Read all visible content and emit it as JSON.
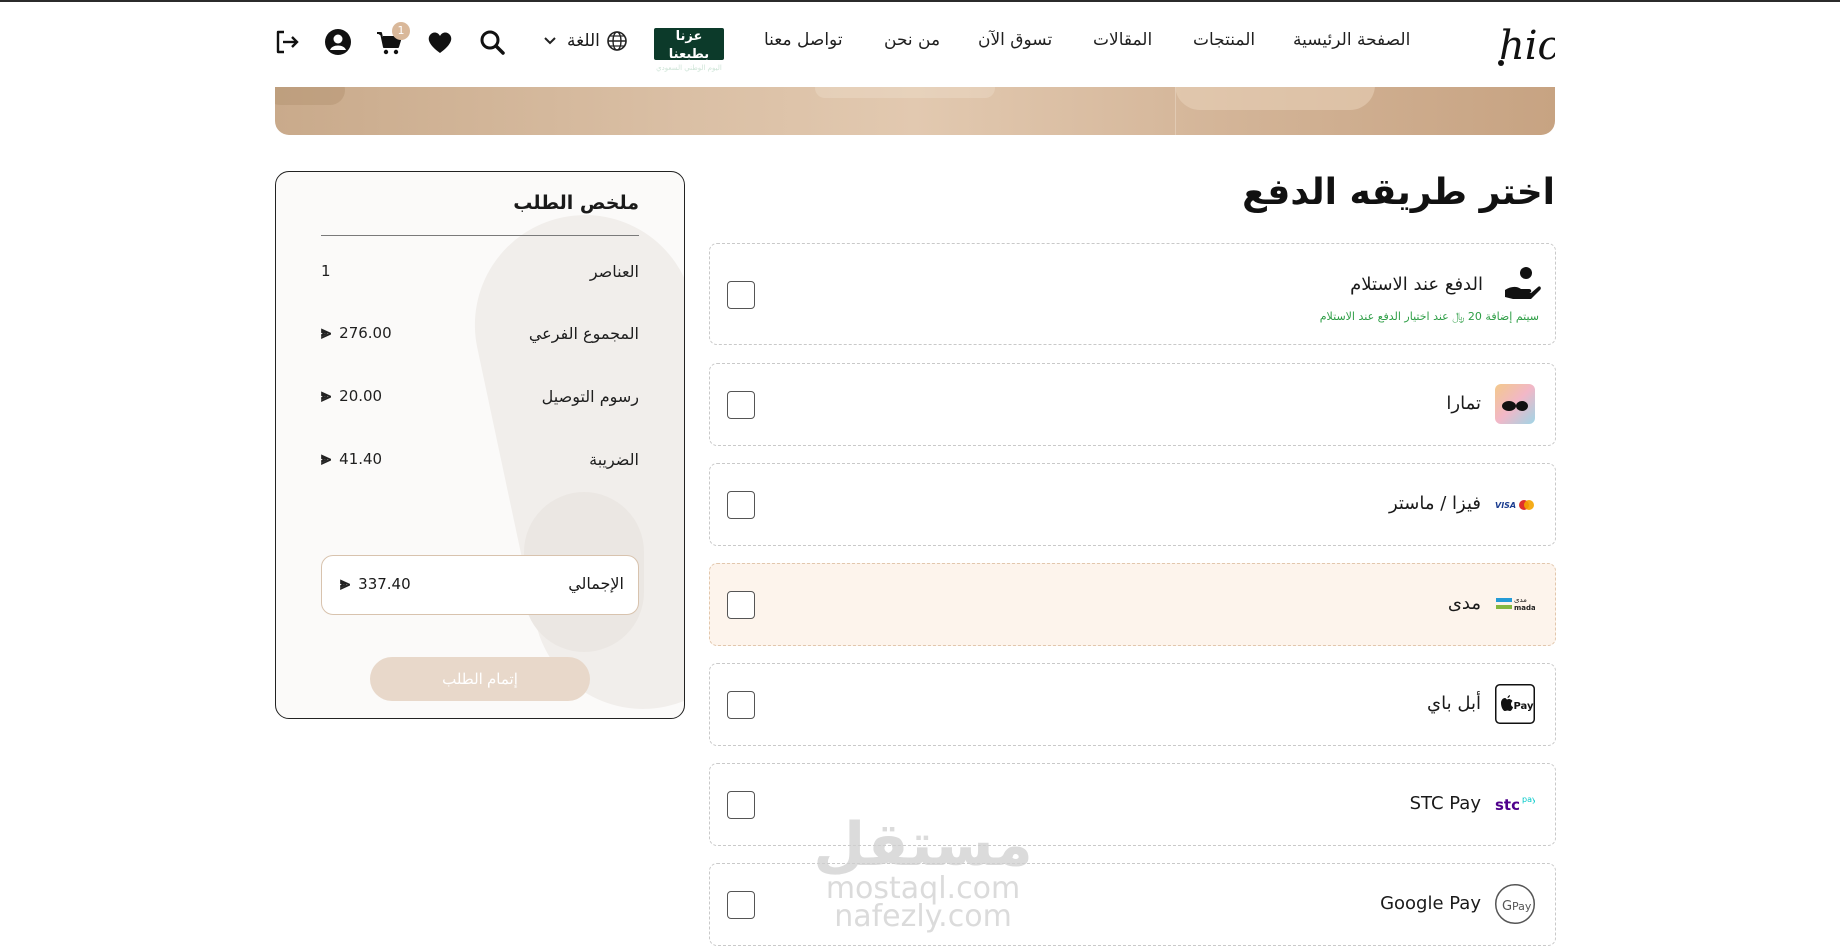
{
  "header": {
    "nav": {
      "home": "الصفحة الرئيسية",
      "products": "المنتجات",
      "articles": "المقالات",
      "shop_now": "تسوق الآن",
      "about": "من نحن",
      "contact": "تواصل معنا"
    },
    "badge_logo": {
      "line1": "عزنا بطبعنا",
      "line2": "اليوم الوطني السعودي"
    },
    "language_label": "اللغة",
    "cart_count": "1",
    "icons": [
      "globe-icon",
      "chevron-down-icon",
      "search-icon",
      "heart-icon",
      "cart-icon",
      "user-icon",
      "logout-icon"
    ]
  },
  "payment": {
    "title": "اختر طريقه الدفع",
    "options": [
      {
        "label": "الدفع عند الاستلام",
        "note": "سيتم إضافة 20 ﷼ عند اختيار الدفع عند الاستلام",
        "icon": "cash-on-delivery-icon",
        "selected": false
      },
      {
        "label": "تمارا",
        "icon": "tamara-icon",
        "selected": false
      },
      {
        "label": "فيزا / ماستر",
        "icon": "visa-mastercard-icon",
        "selected": false
      },
      {
        "label": "مدى",
        "icon": "mada-icon",
        "selected": false,
        "highlighted": true
      },
      {
        "label": "أبل باي",
        "icon": "apple-pay-icon",
        "selected": false
      },
      {
        "label": "STC Pay",
        "icon": "stc-pay-icon",
        "selected": false
      },
      {
        "label": "Google Pay",
        "icon": "google-pay-icon",
        "selected": false
      }
    ]
  },
  "summary": {
    "title": "ملخص الطلب",
    "items_label": "العناصر",
    "items_value": "1",
    "subtotal_label": "المجموع الفرعي",
    "subtotal_value": "276.00",
    "delivery_label": "رسوم التوصيل",
    "delivery_value": "20.00",
    "tax_label": "الضريبة",
    "tax_value": "41.40",
    "total_label": "الإجمالي",
    "total_value": "337.40",
    "place_order": "إتمام الطلب",
    "currency_icon": "riyal-icon"
  },
  "watermark": {
    "line1": "مستقل",
    "line2": "mostaql.com",
    "line3": "nafezly.com"
  },
  "colors": {
    "accent": "#d9b89a",
    "note_green": "#2e9e46",
    "active_bg": "#fdf4ec"
  }
}
